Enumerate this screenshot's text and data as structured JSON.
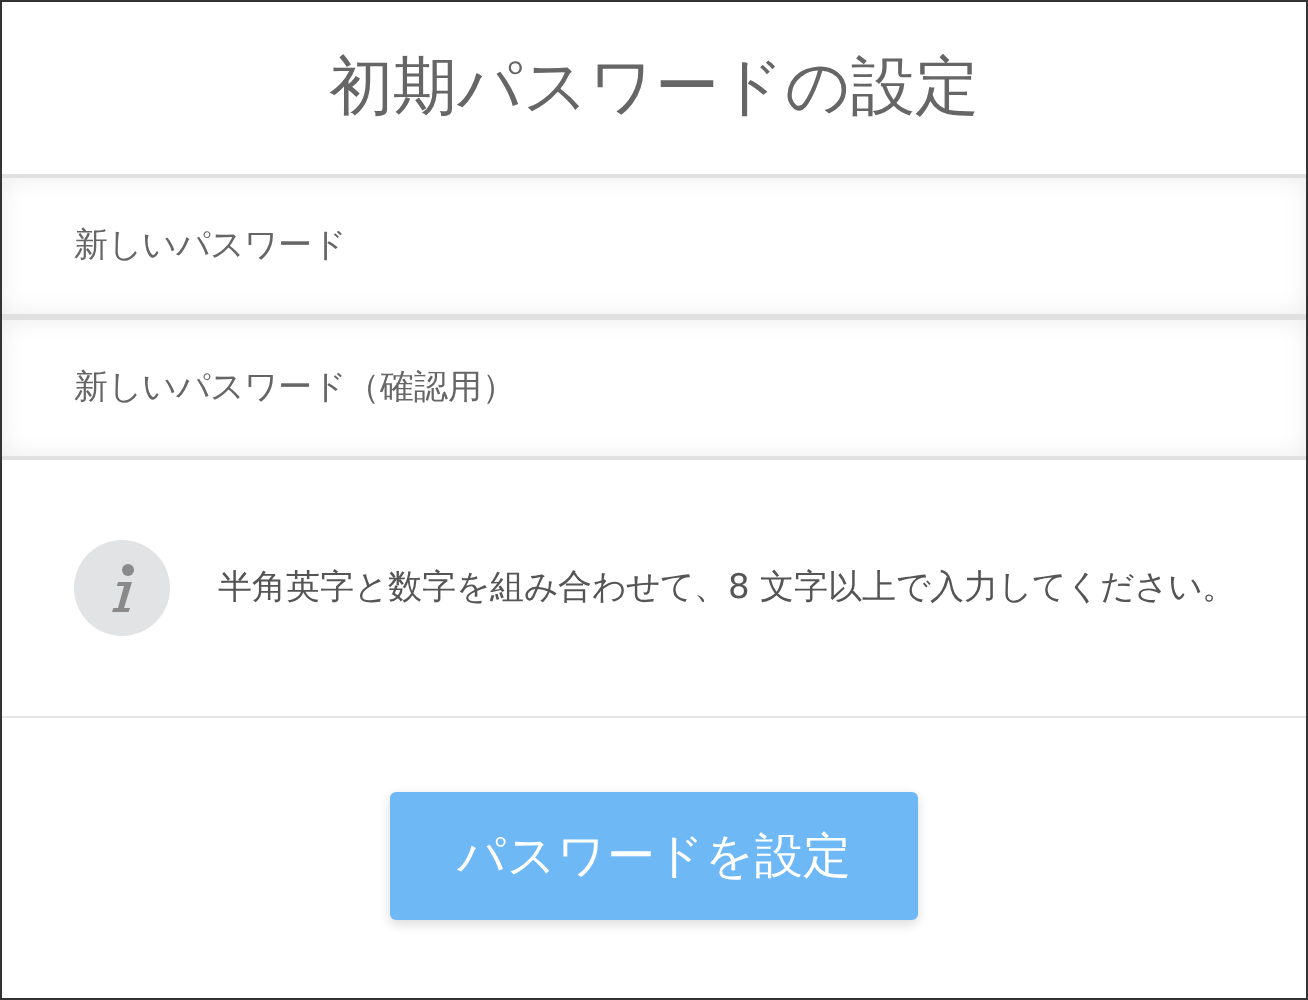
{
  "title": "初期パスワードの設定",
  "fields": [
    {
      "placeholder": "新しいパスワード"
    },
    {
      "placeholder": "新しいパスワード（確認用）"
    }
  ],
  "notice": {
    "text": "半角英字と数字を組み合わせて、8 文字以上で入力してください。"
  },
  "submit_button": {
    "label": "パスワードを設定"
  }
}
